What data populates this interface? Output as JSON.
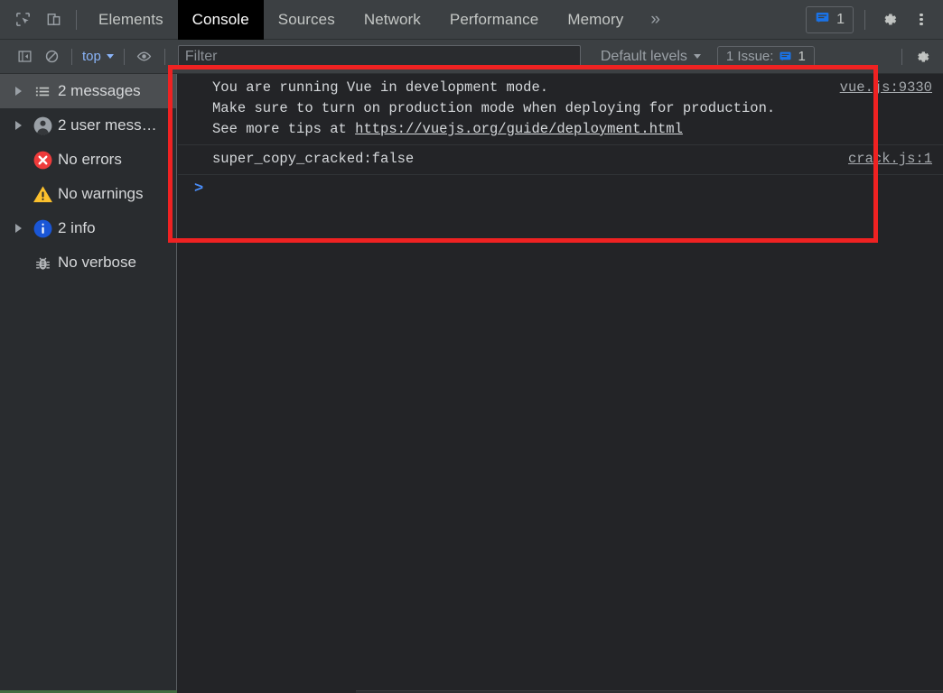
{
  "devtools": {
    "toolbar": {
      "inspect_icon": "inspect-element-icon",
      "device_icon": "device-toolbar-icon",
      "tabs": [
        {
          "label": "Elements",
          "active": false
        },
        {
          "label": "Console",
          "active": true
        },
        {
          "label": "Sources",
          "active": false
        },
        {
          "label": "Network",
          "active": false
        },
        {
          "label": "Performance",
          "active": false
        },
        {
          "label": "Memory",
          "active": false
        }
      ],
      "more_tabs_icon": "»",
      "issues_badge": {
        "icon": "issues-message-icon",
        "count": "1"
      },
      "settings_icon": "gear-icon",
      "menu_icon": "kebab-menu-icon"
    },
    "filterbar": {
      "sidebar_toggle_icon": "sidebar-toggle-icon",
      "clear_console_icon": "clear-console-icon",
      "context_selector": "top",
      "eye_icon": "live-expression-eye-icon",
      "filter_placeholder": "Filter",
      "filter_value": "",
      "levels_label": "Default levels",
      "issue_label": "1 Issue:",
      "issue_count": "1",
      "settings_icon": "console-settings-gear-icon"
    },
    "sidebar": {
      "items": [
        {
          "label": "2 messages",
          "icon": "list-icon",
          "expandable": true,
          "selected": true
        },
        {
          "label": "2 user mess…",
          "icon": "user-icon",
          "expandable": true,
          "selected": false
        },
        {
          "label": "No errors",
          "icon": "error-icon",
          "expandable": false,
          "selected": false
        },
        {
          "label": "No warnings",
          "icon": "warning-icon",
          "expandable": false,
          "selected": false
        },
        {
          "label": "2 info",
          "icon": "info-icon",
          "expandable": true,
          "selected": false
        },
        {
          "label": "No verbose",
          "icon": "bug-icon",
          "expandable": false,
          "selected": false
        }
      ]
    },
    "console": {
      "messages": [
        {
          "line1": "You are running Vue in development mode.",
          "line2": "Make sure to turn on production mode when deploying for production.",
          "line3_prefix": "See more tips at ",
          "line3_link": "https://vuejs.org/guide/deployment.html",
          "source": "vue.js:9330"
        },
        {
          "line1": "super_copy_cracked:false",
          "source": "crack.js:1"
        }
      ],
      "prompt": ">"
    },
    "annotation": {
      "color": "#ef2222",
      "shape": "rectangle"
    }
  }
}
